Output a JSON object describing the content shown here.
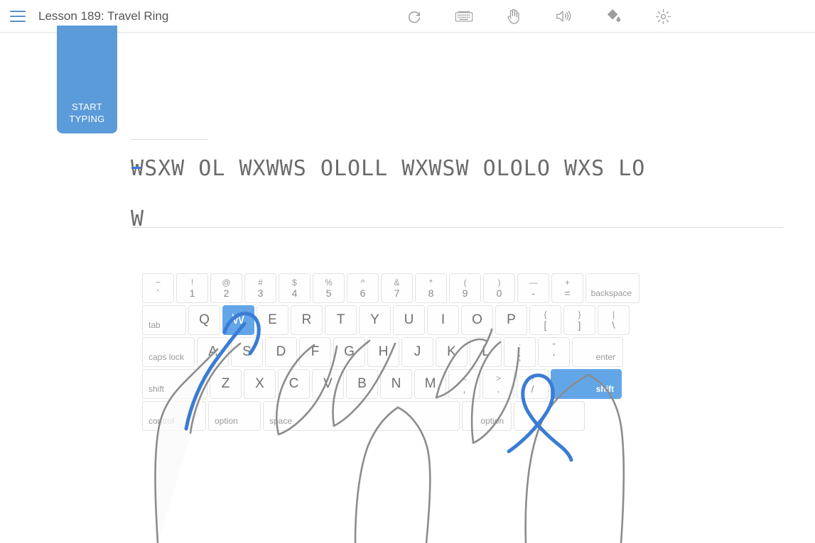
{
  "header": {
    "menu_icon": "hamburger-icon",
    "title": "Lesson 189: Travel Ring",
    "tools": [
      {
        "name": "restart-icon",
        "label": "Restart"
      },
      {
        "name": "keyboard-icon",
        "label": "Keyboard"
      },
      {
        "name": "hand-icon",
        "label": "Hands"
      },
      {
        "name": "sound-icon",
        "label": "Sound"
      },
      {
        "name": "paint-bucket-icon",
        "label": "Theme"
      },
      {
        "name": "gear-icon",
        "label": "Settings"
      }
    ]
  },
  "start_button": {
    "line1": "START",
    "line2": "TYPING"
  },
  "lesson_text": {
    "line1_before_cursor": "",
    "cursor_char": "W",
    "line1_after_cursor": "SXW OL WXWWS OLOLL WXWSW OLOLO WXS LO",
    "line2": "W",
    "full_text": "WSXW OL WXWWS OLOLL WXWSW OLOLO WXS LO W"
  },
  "colors": {
    "accent_blue": "#5b9bd9",
    "key_active_blue": "#63a6e8",
    "cursor_blue": "#3b78d8",
    "finger_highlight_blue": "#3a7cd5",
    "hand_outline_gray": "#8c8c8c",
    "text_gray": "#6b6b6b"
  },
  "keyboard": {
    "active_keys": [
      "W",
      "shift-right"
    ],
    "rows": [
      {
        "name": "number-row",
        "keys": [
          {
            "type": "dual",
            "top": "~",
            "bot": "`"
          },
          {
            "type": "dual",
            "top": "!",
            "bot": "1"
          },
          {
            "type": "dual",
            "top": "@",
            "bot": "2"
          },
          {
            "type": "dual",
            "top": "#",
            "bot": "3"
          },
          {
            "type": "dual",
            "top": "$",
            "bot": "4"
          },
          {
            "type": "dual",
            "top": "%",
            "bot": "5"
          },
          {
            "type": "dual",
            "top": "^",
            "bot": "6"
          },
          {
            "type": "dual",
            "top": "&",
            "bot": "7"
          },
          {
            "type": "dual",
            "top": "*",
            "bot": "8"
          },
          {
            "type": "dual",
            "top": "(",
            "bot": "9"
          },
          {
            "type": "dual",
            "top": ")",
            "bot": "0"
          },
          {
            "type": "dual",
            "top": "—",
            "bot": "-"
          },
          {
            "type": "dual",
            "top": "+",
            "bot": "="
          },
          {
            "type": "mod",
            "label": "backspace",
            "width": "w-bksp",
            "align": "right"
          }
        ]
      },
      {
        "name": "qwerty-row",
        "keys": [
          {
            "type": "mod",
            "label": "tab",
            "width": "w-tab"
          },
          {
            "type": "letter",
            "label": "Q"
          },
          {
            "type": "letter",
            "label": "W",
            "active": true
          },
          {
            "type": "letter",
            "label": "E"
          },
          {
            "type": "letter",
            "label": "R"
          },
          {
            "type": "letter",
            "label": "T"
          },
          {
            "type": "letter",
            "label": "Y"
          },
          {
            "type": "letter",
            "label": "U"
          },
          {
            "type": "letter",
            "label": "I"
          },
          {
            "type": "letter",
            "label": "O"
          },
          {
            "type": "letter",
            "label": "P"
          },
          {
            "type": "dual",
            "top": "{",
            "bot": "["
          },
          {
            "type": "dual",
            "top": "}",
            "bot": "]"
          },
          {
            "type": "dual",
            "top": "|",
            "bot": "\\"
          }
        ]
      },
      {
        "name": "home-row",
        "keys": [
          {
            "type": "mod",
            "label": "caps lock",
            "width": "w-caps"
          },
          {
            "type": "letter",
            "label": "A"
          },
          {
            "type": "letter",
            "label": "S"
          },
          {
            "type": "letter",
            "label": "D"
          },
          {
            "type": "letter",
            "label": "F"
          },
          {
            "type": "letter",
            "label": "G"
          },
          {
            "type": "letter",
            "label": "H"
          },
          {
            "type": "letter",
            "label": "J"
          },
          {
            "type": "letter",
            "label": "K"
          },
          {
            "type": "letter",
            "label": "L"
          },
          {
            "type": "dual",
            "top": ":",
            "bot": ";"
          },
          {
            "type": "dual",
            "top": "\"",
            "bot": "'"
          },
          {
            "type": "mod",
            "label": "enter",
            "width": "w-enter",
            "align": "right"
          }
        ]
      },
      {
        "name": "bottom-letter-row",
        "keys": [
          {
            "type": "mod",
            "label": "shift",
            "width": "w-shift-l"
          },
          {
            "type": "letter",
            "label": "Z"
          },
          {
            "type": "letter",
            "label": "X"
          },
          {
            "type": "letter",
            "label": "C"
          },
          {
            "type": "letter",
            "label": "V"
          },
          {
            "type": "letter",
            "label": "B"
          },
          {
            "type": "letter",
            "label": "N"
          },
          {
            "type": "letter",
            "label": "M"
          },
          {
            "type": "dual",
            "top": "<",
            "bot": ","
          },
          {
            "type": "dual",
            "top": ">",
            "bot": "."
          },
          {
            "type": "dual",
            "top": "?",
            "bot": "/"
          },
          {
            "type": "mod",
            "label": "shift",
            "width": "w-shift-r",
            "align": "right",
            "active": true
          }
        ]
      },
      {
        "name": "modifier-row",
        "keys": [
          {
            "type": "mod",
            "label": "control",
            "width": "w-ctrl"
          },
          {
            "type": "mod",
            "label": "option",
            "width": "w-opt"
          },
          {
            "type": "mod",
            "label": "space",
            "width": "w-space"
          },
          {
            "type": "mod",
            "label": "option",
            "width": "w-opt2",
            "align": "right"
          },
          {
            "type": "mod",
            "label": "",
            "width": "w-cmd"
          }
        ]
      }
    ]
  }
}
